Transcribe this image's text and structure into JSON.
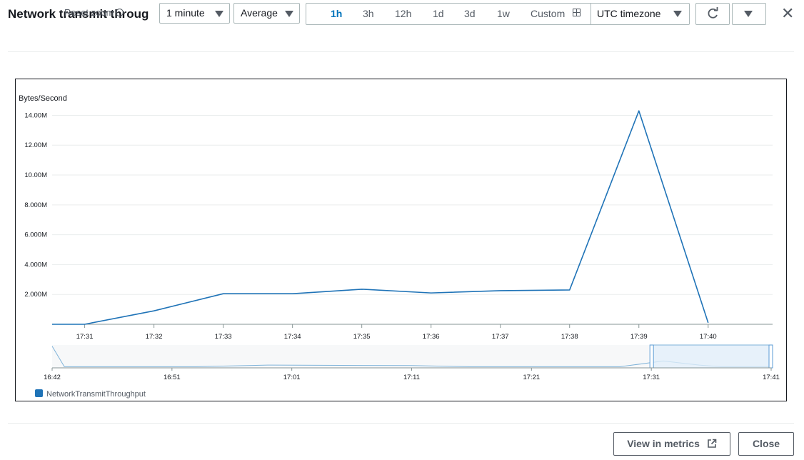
{
  "header": {
    "title": "Network transmit throug",
    "reset_zoom": "Reset zoom",
    "period": "1 minute",
    "statistic": "Average",
    "ranges": [
      "1h",
      "3h",
      "12h",
      "1d",
      "3d",
      "1w"
    ],
    "active_range": "1h",
    "custom_label": "Custom",
    "timezone": "UTC timezone"
  },
  "footer": {
    "view_in_metrics": "View in metrics",
    "close": "Close"
  },
  "colors": {
    "series": "#1f73b7",
    "accent": "#0073bb"
  },
  "chart_data": {
    "type": "line",
    "ylabel": "Bytes/Second",
    "y_ticks": [
      "2.000M",
      "4.000M",
      "6.000M",
      "8.000M",
      "10.00M",
      "12.00M",
      "14.00M"
    ],
    "y_tick_values": [
      2000000,
      4000000,
      6000000,
      8000000,
      10000000,
      12000000,
      14000000
    ],
    "ylim": [
      0,
      14500000
    ],
    "x_ticks": [
      "17:31",
      "17:32",
      "17:33",
      "17:34",
      "17:35",
      "17:36",
      "17:37",
      "17:38",
      "17:39",
      "17:40"
    ],
    "xlim_minutes": [
      30.53,
      40.93
    ],
    "grid": true,
    "legend_position": "bottom-left",
    "series": [
      {
        "name": "NetworkTransmitThroughput",
        "x": [
          "17:30.5",
          "17:31",
          "17:32",
          "17:33",
          "17:34",
          "17:35",
          "17:36",
          "17:37",
          "17:38",
          "17:39",
          "17:40"
        ],
        "x_minutes": [
          30.53,
          31,
          32,
          33,
          34,
          35,
          36,
          37,
          38,
          39,
          40
        ],
        "values": [
          0,
          0,
          900000,
          2050000,
          2050000,
          2350000,
          2100000,
          2250000,
          2300000,
          14300000,
          100000
        ]
      }
    ],
    "navigator": {
      "x_ticks": [
        "16:42",
        "16:51",
        "17:01",
        "17:11",
        "17:21",
        "17:31",
        "17:41"
      ],
      "selection": [
        "17:31",
        "17:41"
      ]
    }
  }
}
